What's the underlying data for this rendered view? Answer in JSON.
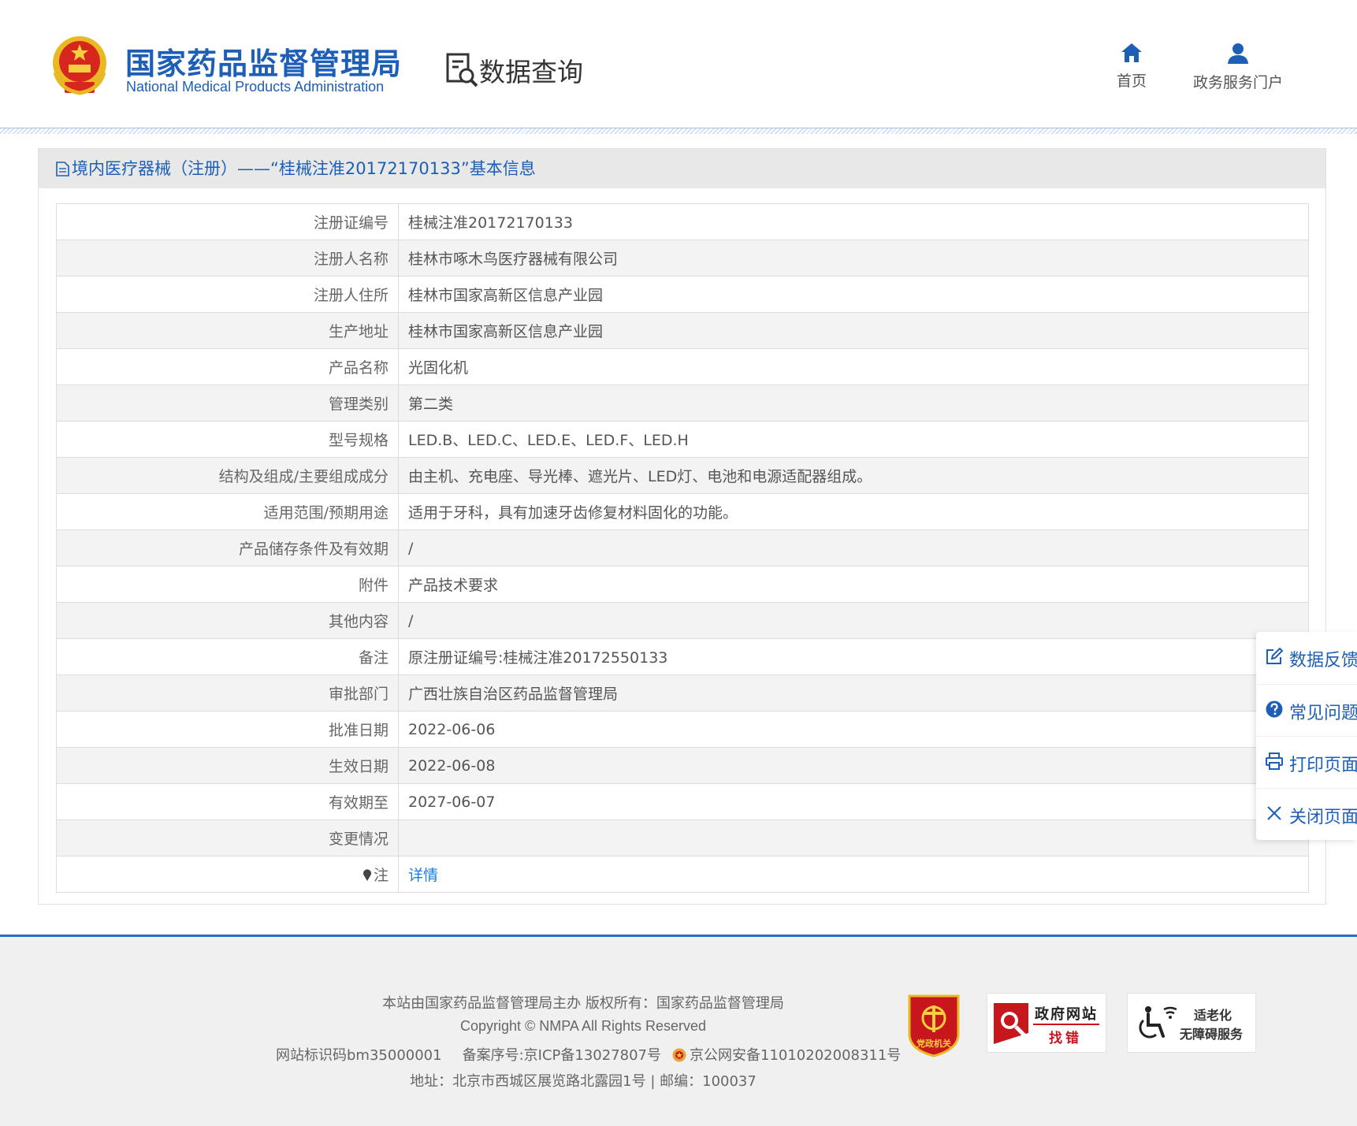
{
  "header": {
    "logo_cn": "国家药品监督管理局",
    "logo_en": "National Medical Products Administration",
    "section": "数据查询",
    "nav": [
      {
        "label": "首页",
        "icon": "home-icon"
      },
      {
        "label": "政务服务门户",
        "icon": "user-icon"
      }
    ]
  },
  "panel": {
    "title": "境内医疗器械（注册）——“桂械注准20172170133”基本信息"
  },
  "rows": [
    {
      "label": "注册证编号",
      "value": "桂械注准20172170133"
    },
    {
      "label": "注册人名称",
      "value": "桂林市啄木鸟医疗器械有限公司"
    },
    {
      "label": "注册人住所",
      "value": "桂林市国家高新区信息产业园"
    },
    {
      "label": "生产地址",
      "value": "桂林市国家高新区信息产业园"
    },
    {
      "label": "产品名称",
      "value": "光固化机"
    },
    {
      "label": "管理类别",
      "value": "第二类"
    },
    {
      "label": "型号规格",
      "value": "LED.B、LED.C、LED.E、LED.F、LED.H"
    },
    {
      "label": "结构及组成/主要组成成分",
      "value": "由主机、充电座、导光棒、遮光片、LED灯、电池和电源适配器组成。"
    },
    {
      "label": "适用范围/预期用途",
      "value": "适用于牙科，具有加速牙齿修复材料固化的功能。"
    },
    {
      "label": "产品储存条件及有效期",
      "value": "/"
    },
    {
      "label": "附件",
      "value": "产品技术要求"
    },
    {
      "label": "其他内容",
      "value": "/"
    },
    {
      "label": "备注",
      "value": "原注册证编号:桂械注准20172550133"
    },
    {
      "label": "审批部门",
      "value": "广西壮族自治区药品监督管理局"
    },
    {
      "label": "批准日期",
      "value": "2022-06-06"
    },
    {
      "label": "生效日期",
      "value": "2022-06-08"
    },
    {
      "label": "有效期至",
      "value": "2027-06-07"
    },
    {
      "label": "变更情况",
      "value": ""
    }
  ],
  "note": {
    "label": "注",
    "link": "详情"
  },
  "side_bar": [
    {
      "label": "数据反馈",
      "icon": "edit-icon"
    },
    {
      "label": "常见问题",
      "icon": "question-icon"
    },
    {
      "label": "打印页面",
      "icon": "printer-icon"
    },
    {
      "label": "关闭页面",
      "icon": "close-icon"
    }
  ],
  "footer": {
    "line1": "本站由国家药品监督管理局主办 版权所有：国家药品监督管理局",
    "line2": "Copyright © NMPA All Rights Reserved",
    "site_id": "网站标识码bm35000001",
    "icp": "备案序号:京ICP备13027807号",
    "police": "京公网安备11010202008311号",
    "address": "地址：北京市西城区展览路北露园1号 | 邮编：100037",
    "badges": {
      "party": "党政机关",
      "gov_line1": "政府网站",
      "gov_line2": "找错",
      "acc_line1": "适老化",
      "acc_line2": "无障碍服务"
    }
  },
  "colors": {
    "brand_blue": "#1d5fb6",
    "link_blue": "#1d7ddf",
    "alert_red": "#c8161d"
  }
}
